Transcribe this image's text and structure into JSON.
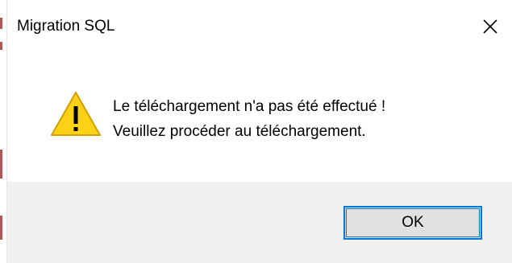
{
  "window": {
    "title": "Migration SQL",
    "close_icon": "close-icon"
  },
  "message": {
    "icon": "warning-icon",
    "line1": "Le téléchargement n'a pas été effectué !",
    "line2": "Veuillez procéder au téléchargement."
  },
  "buttons": {
    "ok_label": "OK"
  },
  "colors": {
    "accent": "#0078d7",
    "footer_bg": "#f0f0f0",
    "warning_fill": "#fcd116"
  }
}
